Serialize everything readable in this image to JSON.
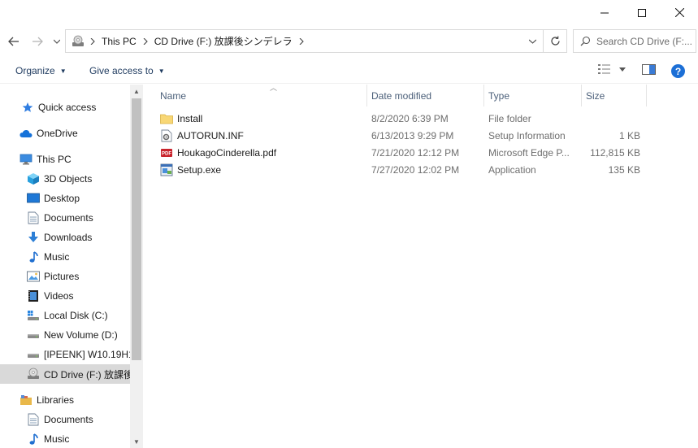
{
  "window": {
    "controls": {
      "minimize": "minimize-icon",
      "maximize": "maximize-icon",
      "close": "close-icon"
    }
  },
  "navigation": {
    "back": "back-arrow-icon",
    "forward": "forward-arrow-icon",
    "recent": "chevron-down-icon",
    "breadcrumbs": [
      "This PC",
      "CD Drive (F:) 放課後シンデレラ"
    ],
    "refresh": "refresh-icon"
  },
  "search": {
    "placeholder": "Search CD Drive (F:..."
  },
  "toolbar": {
    "organize": "Organize",
    "give_access": "Give access to"
  },
  "sidebar": {
    "items": [
      {
        "label": "Quick access",
        "icon": "star-icon"
      },
      {
        "label": "OneDrive",
        "icon": "cloud-icon"
      },
      {
        "label": "This PC",
        "icon": "computer-icon"
      },
      {
        "label": "3D Objects",
        "icon": "cube-icon"
      },
      {
        "label": "Desktop",
        "icon": "desktop-icon"
      },
      {
        "label": "Documents",
        "icon": "document-icon"
      },
      {
        "label": "Downloads",
        "icon": "download-icon"
      },
      {
        "label": "Music",
        "icon": "music-icon"
      },
      {
        "label": "Pictures",
        "icon": "pictures-icon"
      },
      {
        "label": "Videos",
        "icon": "video-icon"
      },
      {
        "label": "Local Disk (C:)",
        "icon": "windows-drive-icon"
      },
      {
        "label": "New Volume (D:)",
        "icon": "drive-icon"
      },
      {
        "label": "[IPEENK] W10.19H1.",
        "icon": "drive-icon"
      },
      {
        "label": "CD Drive (F:) 放課後",
        "icon": "cd-drive-icon"
      },
      {
        "label": "Libraries",
        "icon": "library-icon"
      },
      {
        "label": "Documents",
        "icon": "document-icon"
      },
      {
        "label": "Music",
        "icon": "music-icon"
      }
    ]
  },
  "columns": {
    "name": "Name",
    "date": "Date modified",
    "type": "Type",
    "size": "Size"
  },
  "files": [
    {
      "name": "Install",
      "date": "8/2/2020 6:39 PM",
      "type": "File folder",
      "size": "",
      "icon": "folder-icon"
    },
    {
      "name": "AUTORUN.INF",
      "date": "6/13/2013 9:29 PM",
      "type": "Setup Information",
      "size": "1 KB",
      "icon": "settings-file-icon"
    },
    {
      "name": "HoukagoCinderella.pdf",
      "date": "7/21/2020 12:12 PM",
      "type": "Microsoft Edge P...",
      "size": "112,815 KB",
      "icon": "pdf-icon"
    },
    {
      "name": "Setup.exe",
      "date": "7/27/2020 12:02 PM",
      "type": "Application",
      "size": "135 KB",
      "icon": "setup-icon"
    }
  ],
  "colors": {
    "accent": "#1c6fd6",
    "folder": "#f8d775",
    "selection": "#d9d9d9"
  }
}
